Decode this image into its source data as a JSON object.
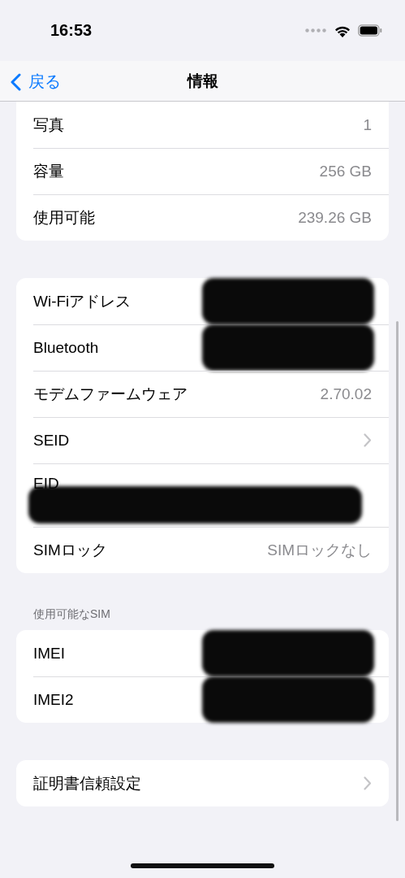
{
  "status_bar": {
    "time": "16:53"
  },
  "nav_bar": {
    "back": "戻る",
    "title": "情報"
  },
  "groups": [
    {
      "rows": [
        {
          "kind": "value",
          "label": "写真",
          "value": "1"
        },
        {
          "kind": "value",
          "label": "容量",
          "value": "256 GB"
        },
        {
          "kind": "value",
          "label": "使用可能",
          "value": "239.26 GB"
        }
      ]
    },
    {
      "rows": [
        {
          "kind": "value",
          "label": "Wi-Fiアドレス",
          "redacted": true
        },
        {
          "kind": "value",
          "label": "Bluetooth",
          "redacted": true
        },
        {
          "kind": "value",
          "label": "モデムファームウェア",
          "value": "2.70.02"
        },
        {
          "kind": "disclosure",
          "label": "SEID"
        },
        {
          "kind": "stacked",
          "label": "EID",
          "redacted": true
        },
        {
          "kind": "value",
          "label": "SIMロック",
          "value": "SIMロックなし"
        }
      ]
    },
    {
      "header": "使用可能なSIM",
      "rows": [
        {
          "kind": "value",
          "label": "IMEI",
          "redacted": true
        },
        {
          "kind": "value",
          "label": "IMEI2",
          "redacted": true
        }
      ]
    },
    {
      "rows": [
        {
          "kind": "disclosure",
          "label": "証明書信頼設定"
        }
      ]
    }
  ]
}
